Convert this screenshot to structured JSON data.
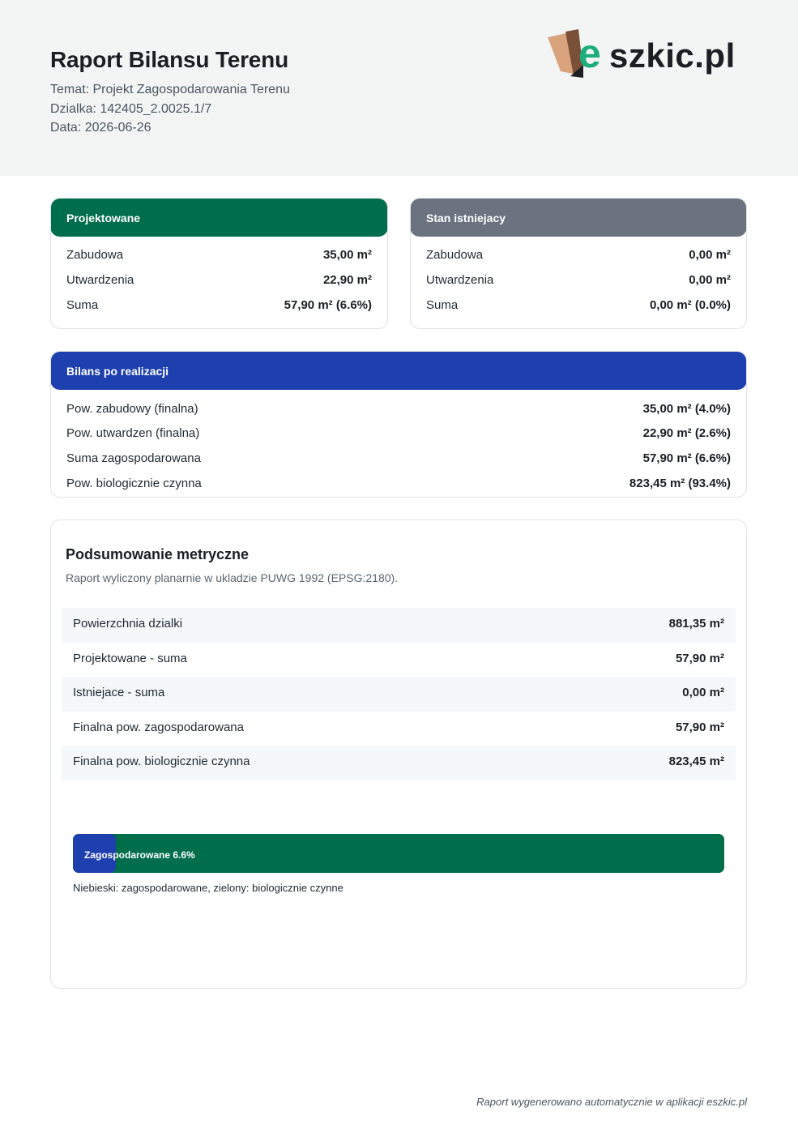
{
  "header": {
    "title": "Raport Bilansu Terenu",
    "topic": "Temat: Projekt Zagospodarowania Terenu",
    "parcel": "Dzialka: 142405_2.0025.1/7",
    "date": "Data: 2026-06-26",
    "logo": {
      "e": "e",
      "rest": "szkic.pl"
    }
  },
  "projected": {
    "title": "Projektowane",
    "rows": [
      {
        "label": "Zabudowa",
        "value": "35,00 m²"
      },
      {
        "label": "Utwardzenia",
        "value": "22,90 m²"
      },
      {
        "label": "Suma",
        "value": "57,90 m² (6.6%)"
      }
    ]
  },
  "existing": {
    "title": "Stan istniejacy",
    "rows": [
      {
        "label": "Zabudowa",
        "value": "0,00 m²"
      },
      {
        "label": "Utwardzenia",
        "value": "0,00 m²"
      },
      {
        "label": "Suma",
        "value": "0,00 m² (0.0%)"
      }
    ]
  },
  "balance": {
    "title": "Bilans po realizacji",
    "rows": [
      {
        "label": "Pow. zabudowy (finalna)",
        "value": "35,00 m² (4.0%)"
      },
      {
        "label": "Pow. utwardzen (finalna)",
        "value": "22,90 m² (2.6%)"
      },
      {
        "label": "Suma zagospodarowana",
        "value": "57,90 m² (6.6%)"
      },
      {
        "label": "Pow. biologicznie czynna",
        "value": "823,45 m² (93.4%)"
      }
    ]
  },
  "summary": {
    "title": "Podsumowanie metryczne",
    "subtitle": "Raport wyliczony planarnie w ukladzie PUWG 1992 (EPSG:2180).",
    "rows": [
      {
        "label": "Powierzchnia dzialki",
        "value": "881,35 m²"
      },
      {
        "label": "Projektowane - suma",
        "value": "57,90 m²"
      },
      {
        "label": "Istniejace - suma",
        "value": "0,00 m²"
      },
      {
        "label": "Finalna pow. zagospodarowana",
        "value": "57,90 m²"
      },
      {
        "label": "Finalna pow. biologicznie czynna",
        "value": "823,45 m²"
      }
    ],
    "bar": {
      "label": "Zagospodarowane 6.6%",
      "developed_fraction": 0.066,
      "developed_color": "#1e3fae",
      "bio_color": "#006e4a"
    },
    "legend": "Niebieski: zagospodarowane, zielony: biologicznie czynne"
  },
  "footer": "Raport wygenerowano automatycznie w aplikacji eszkic.pl"
}
